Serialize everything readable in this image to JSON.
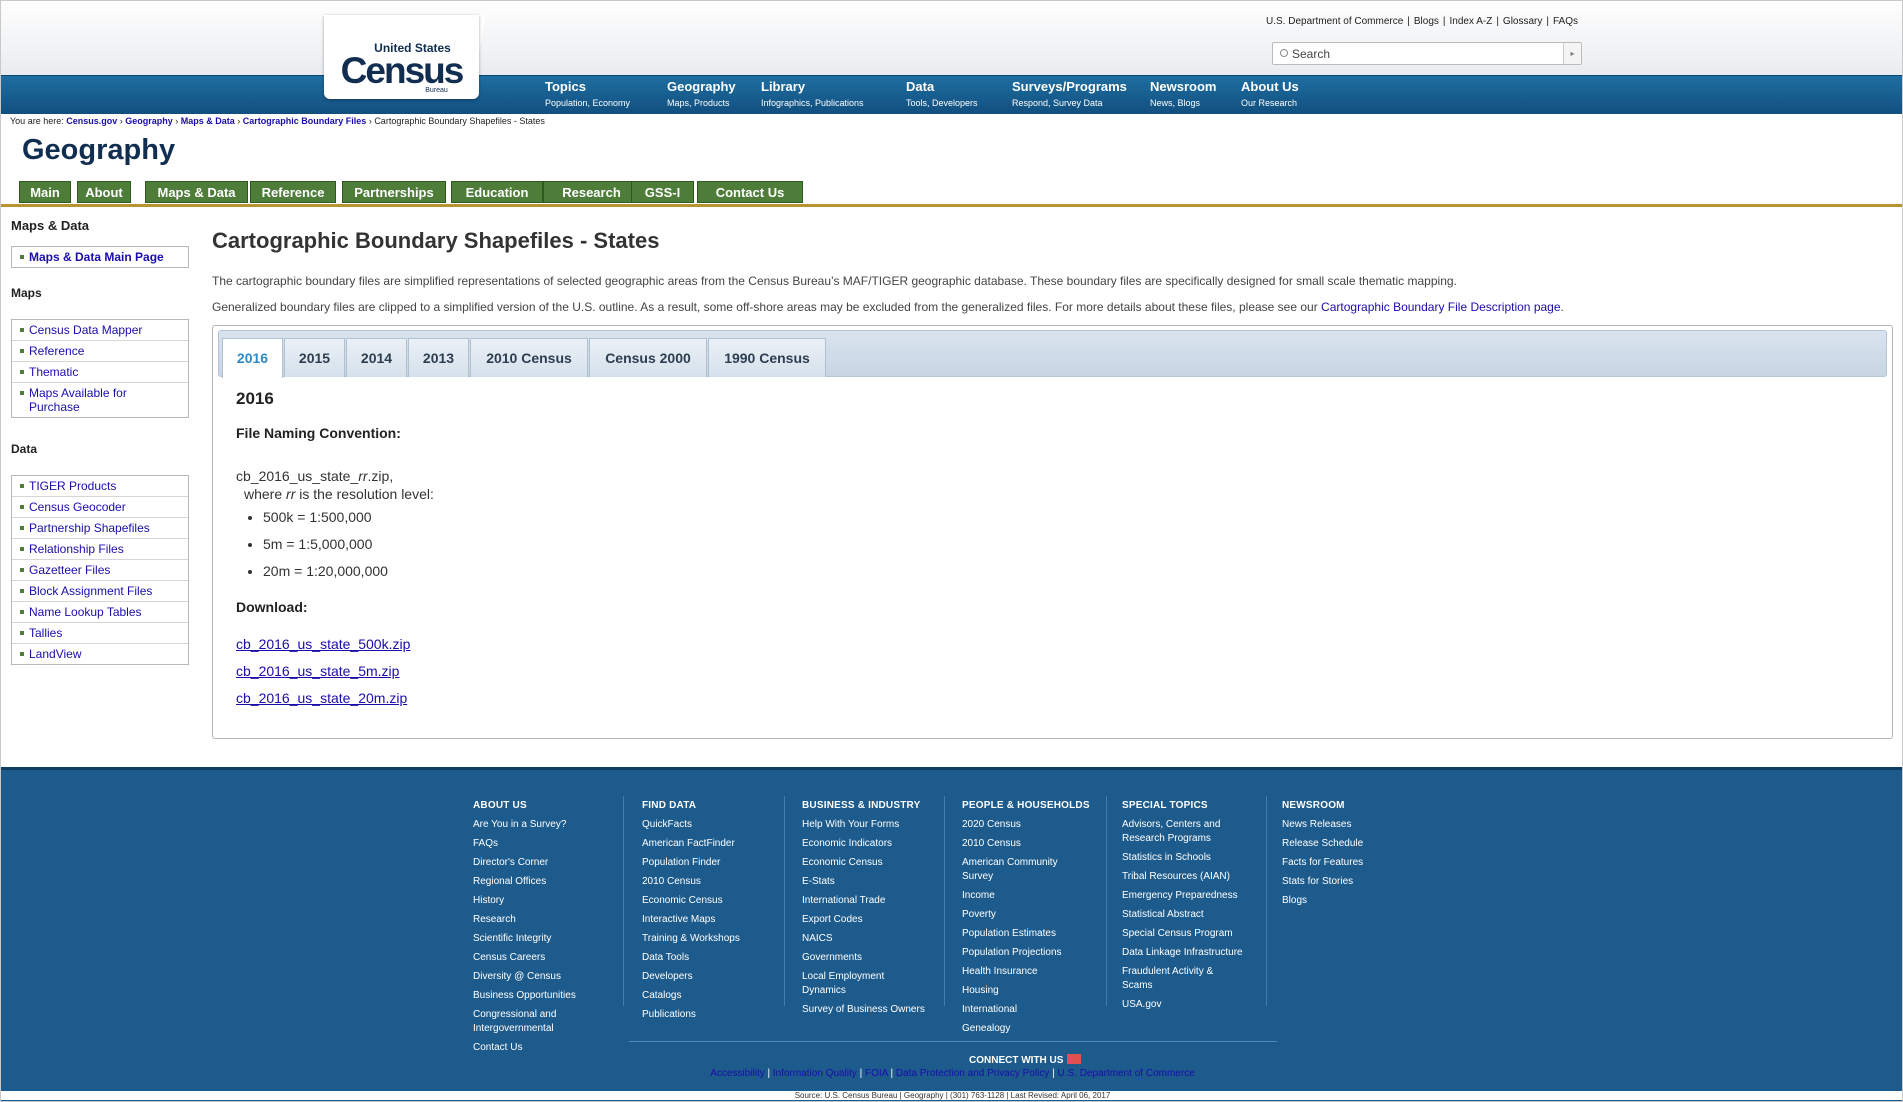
{
  "header": {
    "logo": {
      "line1": "United States",
      "line2": "Census",
      "line3": "Bureau"
    },
    "utility_links": [
      "U.S. Department of Commerce",
      "Blogs",
      "Index A-Z",
      "Glossary",
      "FAQs"
    ],
    "search_placeholder": "Search",
    "nav": [
      {
        "title": "Topics",
        "sub": "Population, Economy"
      },
      {
        "title": "Geography",
        "sub": "Maps, Products"
      },
      {
        "title": "Library",
        "sub": "Infographics, Publications"
      },
      {
        "title": "Data",
        "sub": "Tools, Developers"
      },
      {
        "title": "Surveys/Programs",
        "sub": "Respond, Survey Data"
      },
      {
        "title": "Newsroom",
        "sub": "News, Blogs"
      },
      {
        "title": "About Us",
        "sub": "Our Research"
      }
    ]
  },
  "breadcrumb": {
    "prefix": "You are here:",
    "links": [
      "Census.gov",
      "Geography",
      "Maps & Data",
      "Cartographic Boundary Files"
    ],
    "current": "Cartographic Boundary Shapefiles - States"
  },
  "section_title": "Geography",
  "subnav": [
    "Main",
    "About",
    "Maps & Data",
    "Reference",
    "Partnerships",
    "Education",
    "Research",
    "GSS-I",
    "Contact Us"
  ],
  "sidebar": {
    "heading": "Maps & Data",
    "main_link": "Maps & Data Main Page",
    "maps_heading": "Maps",
    "maps": [
      "Census Data Mapper",
      "Reference",
      "Thematic",
      "Maps Available for Purchase"
    ],
    "data_heading": "Data",
    "data": [
      "TIGER Products",
      "Census Geocoder",
      "Partnership Shapefiles",
      "Relationship Files",
      "Gazetteer Files",
      "Block Assignment Files",
      "Name Lookup Tables",
      "Tallies",
      "LandView"
    ]
  },
  "content": {
    "title": "Cartographic Boundary Shapefiles - States",
    "para1": "The cartographic boundary files are simplified representations of selected geographic areas from the Census Bureau’s MAF/TIGER geographic database. These boundary files are specifically designed for small scale thematic mapping.",
    "para2": "Generalized boundary files are clipped to a simplified version of the U.S. outline. As a result, some off-shore areas may be excluded from the generalized files. For more details about these files, please see our",
    "para2_link": "Cartographic Boundary File Description page",
    "para2_end": ".",
    "tabs": [
      "2016",
      "2015",
      "2014",
      "2013",
      "2010 Census",
      "Census 2000",
      "1990 Census"
    ],
    "active_tab": "2016",
    "tab_heading": "2016",
    "naming_label": "File Naming Convention:",
    "file_pattern_pre": "cb_2016_us_state_",
    "file_pattern_var": "rr",
    "file_pattern_post": ".zip,",
    "where_pre": "where ",
    "where_var": "rr",
    "where_post": " is the resolution level:",
    "resolutions": [
      "500k = 1:500,000",
      "5m = 1:5,000,000",
      "20m = 1:20,000,000"
    ],
    "download_label": "Download:",
    "downloads": [
      "cb_2016_us_state_500k.zip",
      "cb_2016_us_state_5m.zip",
      "cb_2016_us_state_20m.zip"
    ]
  },
  "footer": {
    "columns": [
      {
        "heading": "ABOUT US",
        "links": [
          "Are You in a Survey?",
          "FAQs",
          "Director's Corner",
          "Regional Offices",
          "History",
          "Research",
          "Scientific Integrity",
          "Census Careers",
          "Diversity @ Census",
          "Business Opportunities",
          "Congressional and Intergovernmental",
          "Contact Us"
        ]
      },
      {
        "heading": "FIND DATA",
        "links": [
          "QuickFacts",
          "American FactFinder",
          "Population Finder",
          "2010 Census",
          "Economic Census",
          "Interactive Maps",
          "Training & Workshops",
          "Data Tools",
          "Developers",
          "Catalogs",
          "Publications"
        ]
      },
      {
        "heading": "BUSINESS & INDUSTRY",
        "links": [
          "Help With Your Forms",
          "Economic Indicators",
          "Economic Census",
          "E-Stats",
          "International Trade",
          "Export Codes",
          "NAICS",
          "Governments",
          "Local Employment Dynamics",
          "Survey of Business Owners"
        ]
      },
      {
        "heading": "PEOPLE & HOUSEHOLDS",
        "links": [
          "2020 Census",
          "2010 Census",
          "American Community Survey",
          "Income",
          "Poverty",
          "Population Estimates",
          "Population Projections",
          "Health Insurance",
          "Housing",
          "International",
          "Genealogy"
        ]
      },
      {
        "heading": "SPECIAL TOPICS",
        "links": [
          "Advisors, Centers and Research Programs",
          "Statistics in Schools",
          "Tribal Resources (AIAN)",
          "Emergency Preparedness",
          "Statistical Abstract",
          "Special Census Program",
          "Data Linkage Infrastructure",
          "Fraudulent Activity & Scams",
          "USA.gov"
        ]
      },
      {
        "heading": "NEWSROOM",
        "links": [
          "News Releases",
          "Release Schedule",
          "Facts for Features",
          "Stats for Stories",
          "Blogs"
        ]
      }
    ],
    "connect": "CONNECT WITH US",
    "bottom_links": [
      "Accessibility",
      "Information Quality",
      "FOIA",
      "Data Protection and Privacy Policy",
      "U.S. Department of Commerce"
    ],
    "source": "Source: U.S. Census Bureau | Geography | (301) 763-1128 | Last Revised: April 06, 2017"
  }
}
